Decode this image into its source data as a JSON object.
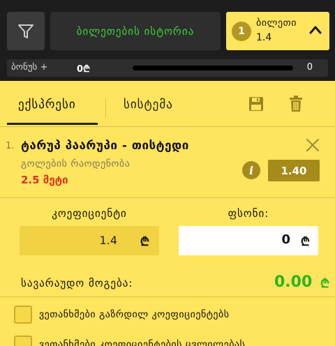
{
  "header": {
    "history_label": "ბილეთების ისტორია",
    "ticket": {
      "count": "1",
      "title": "ბილეთი",
      "value": "1.4"
    }
  },
  "bonus": {
    "label": "ბონუს +",
    "amount": "0₾",
    "right_value": "0"
  },
  "tabs": {
    "express": "ექსპრესი",
    "system": "სისტემა"
  },
  "bet": {
    "number": "1.",
    "title": "ტარუპ პაარუპი - თისტედი",
    "market": "გოლების რაოდენობა",
    "selection": "2.5 მეტი",
    "odds": "1.40"
  },
  "coefficient": {
    "label": "კოეფიციენტი",
    "value": "1.4"
  },
  "stake": {
    "label": "ფსონი:",
    "value": "0"
  },
  "potential_win": {
    "label": "სავარაუდო მოგება:",
    "value": "0.00"
  },
  "currency_symbol": "₾",
  "checkboxes": [
    {
      "label": "ვეთანხმები გაზრდილ კოეფიციენტებს"
    },
    {
      "label": "ვეთანხმები კოეფიციენტების ცვლილებას"
    }
  ],
  "colors": {
    "header_bg": "#1d1d1d",
    "panel_bg": "#ffe45e",
    "accent_green": "#3cd23c",
    "odds_bg": "#a58b1a",
    "selection_red": "#d8351e",
    "win_green": "#2ab51e"
  },
  "icons": [
    "filter-icon",
    "chevron-up-icon",
    "save-icon",
    "trash-icon",
    "close-icon",
    "info-icon",
    "lari-icon"
  ]
}
